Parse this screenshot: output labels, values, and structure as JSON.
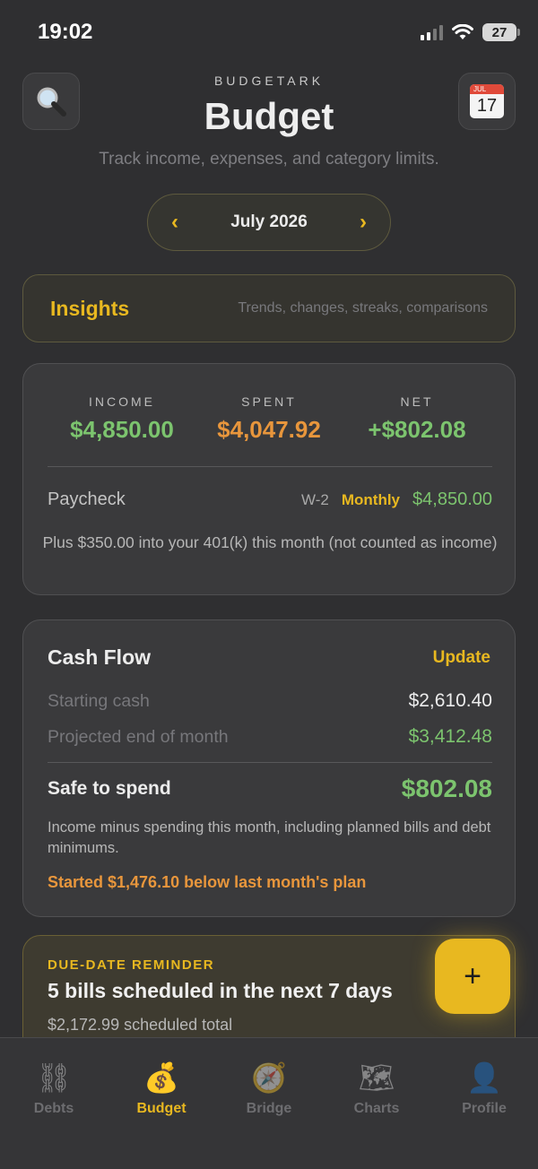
{
  "status": {
    "time": "19:02",
    "battery": "27"
  },
  "header": {
    "brand": "BUDGETARK",
    "title": "Budget",
    "subtitle": "Track income, expenses, and category limits.",
    "search_icon": "magnifier-emoji",
    "calendar_icon": "calendar-emoji",
    "calendar_month": "JUL",
    "calendar_day": "17"
  },
  "month_selector": {
    "label": "July 2026",
    "prev": "‹",
    "next": "›"
  },
  "insights": {
    "title": "Insights",
    "subtitle": "Trends, changes, streaks, comparisons"
  },
  "summary": {
    "income": {
      "label": "INCOME",
      "value": "$4,850.00"
    },
    "spent": {
      "label": "SPENT",
      "value": "$4,047.92"
    },
    "net": {
      "label": "NET",
      "value": "+$802.08"
    },
    "paycheck": {
      "label": "Paycheck",
      "type": "W-2",
      "frequency": "Monthly",
      "amount": "$4,850.00"
    },
    "note": "Plus $350.00 into your 401(k) this month (not counted as income)"
  },
  "cash_flow": {
    "title": "Cash Flow",
    "update_label": "Update",
    "starting_label": "Starting cash",
    "starting_value": "$2,610.40",
    "projected_label": "Projected end of month",
    "projected_value": "$3,412.48",
    "safe_label": "Safe to spend",
    "safe_value": "$802.08",
    "description": "Income minus spending this month, including planned bills and debt minimums.",
    "warning": "Started $1,476.10 below last month's plan"
  },
  "reminder": {
    "eyebrow": "DUE-DATE REMINDER",
    "title": "5 bills scheduled in the next 7 days",
    "subtitle": "$2,172.99 scheduled total"
  },
  "fab": {
    "label": "+"
  },
  "tabs": [
    {
      "label": "Debts",
      "icon": "⛓",
      "active": false
    },
    {
      "label": "Budget",
      "icon": "💰",
      "active": true
    },
    {
      "label": "Bridge",
      "icon": "🧭",
      "active": false
    },
    {
      "label": "Charts",
      "icon": "🗺",
      "active": false
    },
    {
      "label": "Profile",
      "icon": "👤",
      "active": false
    }
  ],
  "colors": {
    "accent": "#e8b820",
    "positive": "#7cc46e",
    "warning": "#e8963c",
    "background": "#2f2f31"
  }
}
